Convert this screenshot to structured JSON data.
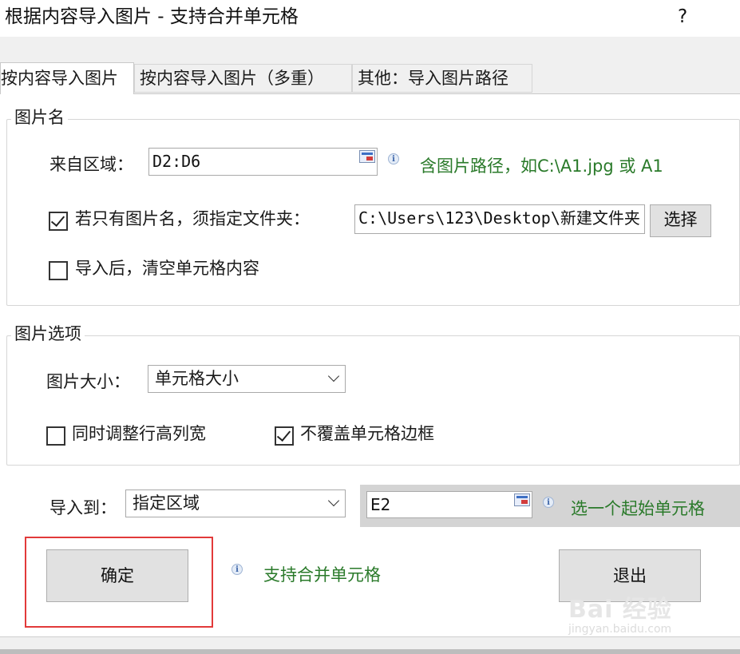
{
  "window": {
    "title": "根据内容导入图片 - 支持合并单元格",
    "help": "?"
  },
  "tabs": [
    {
      "label": "按内容导入图片",
      "active": true
    },
    {
      "label": "按内容导入图片（多重）",
      "active": false
    },
    {
      "label": "其他：导入图片路径",
      "active": false
    }
  ],
  "image_name_group": {
    "legend": "图片名",
    "source_range_label": "来自区域：",
    "source_range_value": "D2:D6",
    "path_hint": "含图片路径，如C:\\A1.jpg 或 A1",
    "folder_checkbox_label": "若只有图片名，须指定文件夹：",
    "folder_checked": true,
    "folder_value": "C:\\Users\\123\\Desktop\\新建文件夹",
    "select_button": "选择",
    "clear_checkbox_label": "导入后，清空单元格内容",
    "clear_checked": false
  },
  "image_options_group": {
    "legend": "图片选项",
    "size_label": "图片大小：",
    "size_value": "单元格大小",
    "adjust_checkbox_label": "同时调整行高列宽",
    "adjust_checked": false,
    "border_checkbox_label": "不覆盖单元格边框",
    "border_checked": true
  },
  "import_to": {
    "label": "导入到：",
    "value": "指定区域",
    "cell_value": "E2",
    "hint": "选一个起始单元格"
  },
  "footer": {
    "ok_button": "确定",
    "merge_hint": "支持合并单元格",
    "exit_button": "退出"
  },
  "watermark": {
    "text": "Bai 经验",
    "sub": "jingyan.baidu.com"
  },
  "colors": {
    "hint_green": "#2a7a2a",
    "highlight_red": "#e23a3a",
    "button_grey": "#e1e1e1"
  }
}
